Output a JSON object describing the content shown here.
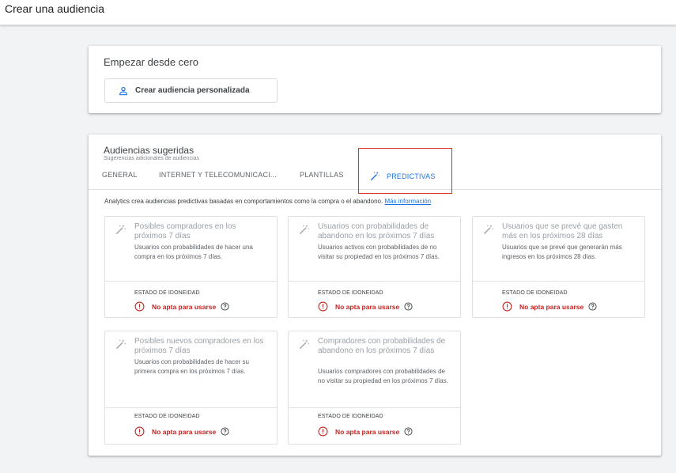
{
  "header": {
    "title": "Crear una audiencia"
  },
  "start": {
    "heading": "Empezar desde cero",
    "create_button": "Crear audiencia personalizada"
  },
  "suggested": {
    "heading": "Audiencias sugeridas",
    "subheading": "Sugerencias adicionales de audiencias",
    "tabs": [
      {
        "label": "GENERAL"
      },
      {
        "label": "INTERNET Y TELECOMUNICACI..."
      },
      {
        "label": "PLANTILLAS"
      },
      {
        "label": "PREDICTIVAS",
        "active": true
      }
    ],
    "description": "Analytics crea audiencias predictivas basadas en comportamientos como la compra o el abandono.",
    "more_info": "Más información",
    "status_label": "ESTADO DE IDONEIDAD",
    "status_text": "No apta para usarse",
    "cards": [
      {
        "title": "Posibles compradores en los próximos 7 días",
        "desc": "Usuarios con probabilidades de hacer una compra en los próximos 7 días."
      },
      {
        "title": "Usuarios con probabilidades de abandono en los próximos 7 días",
        "desc": "Usuarios activos con probabilidades de no visitar su propiedad en los próximos 7 días."
      },
      {
        "title": "Usuarios que se prevé que gasten más en los próximos 28 días",
        "desc": "Usuarios que se prevé que generarán más ingresos en los próximos 28 días."
      },
      {
        "title": "Posibles nuevos compradores en los próximos 7 días",
        "desc": "Usuarios con probabilidades de hacer su primera compra en los próximos 7 días."
      },
      {
        "title": "Compradores con probabilidades de abandono en los próximos 7 días",
        "desc": "Usuarios compradores con probabilidades de no visitar su propiedad en los próximos 7 días."
      }
    ]
  },
  "colors": {
    "accent": "#1a73e8",
    "error": "#c5221f",
    "highlight": "#d93025"
  },
  "icons": {
    "person": "person-outline-icon",
    "wand": "magic-wand-icon",
    "warning": "error-outline-icon",
    "help": "help-outline-icon"
  }
}
